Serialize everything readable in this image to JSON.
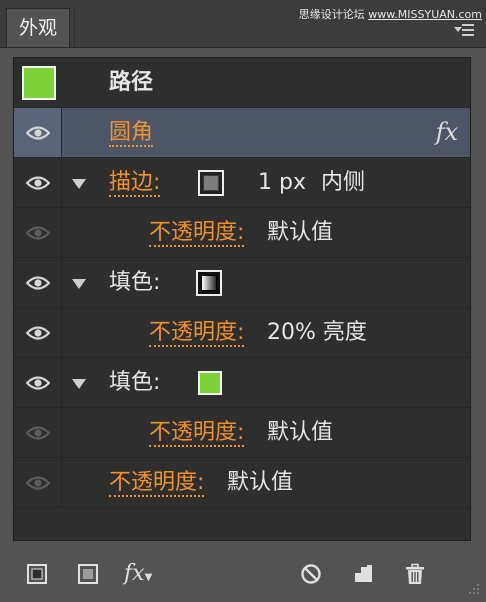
{
  "panel": {
    "tab_label": "外观",
    "watermark": {
      "left": "思缘设计论坛 ",
      "right": "www.MISSYUAN.com"
    }
  },
  "colors": {
    "fill_swatch": "#7ed33a",
    "link": "#f0922e",
    "selected_row": "#4d5566",
    "panel_bg": "#2e2e2e"
  },
  "object": {
    "type_label": "路径"
  },
  "rows": [
    {
      "label": "圆角",
      "fx": "fx",
      "eye_visible": true,
      "selected": true
    },
    {
      "label": "描边:",
      "stroke_weight": "1 px",
      "stroke_align": "内侧",
      "eye_visible": true,
      "expanded": true,
      "swatch_icon": "stroke-swatch-icon"
    },
    {
      "label": "不透明度:",
      "value": "默认值",
      "eye_visible": false
    },
    {
      "label": "填色:",
      "eye_visible": true,
      "expanded": true,
      "swatch_icon": "gradient-swatch-icon"
    },
    {
      "label": "不透明度:",
      "value": "20% 亮度",
      "eye_visible": true
    },
    {
      "label": "填色:",
      "eye_visible": true,
      "expanded": true,
      "swatch_icon": "green-swatch-icon"
    },
    {
      "label": "不透明度:",
      "value": "默认值",
      "eye_visible": false
    },
    {
      "label": "不透明度:",
      "value": "默认值",
      "eye_visible": false
    }
  ],
  "toolbar": {
    "fx_label": "fx",
    "icons": [
      "add-stroke-icon",
      "add-fill-icon",
      "fx-menu-icon",
      "clear-appearance-icon",
      "duplicate-item-icon",
      "delete-item-icon"
    ]
  }
}
